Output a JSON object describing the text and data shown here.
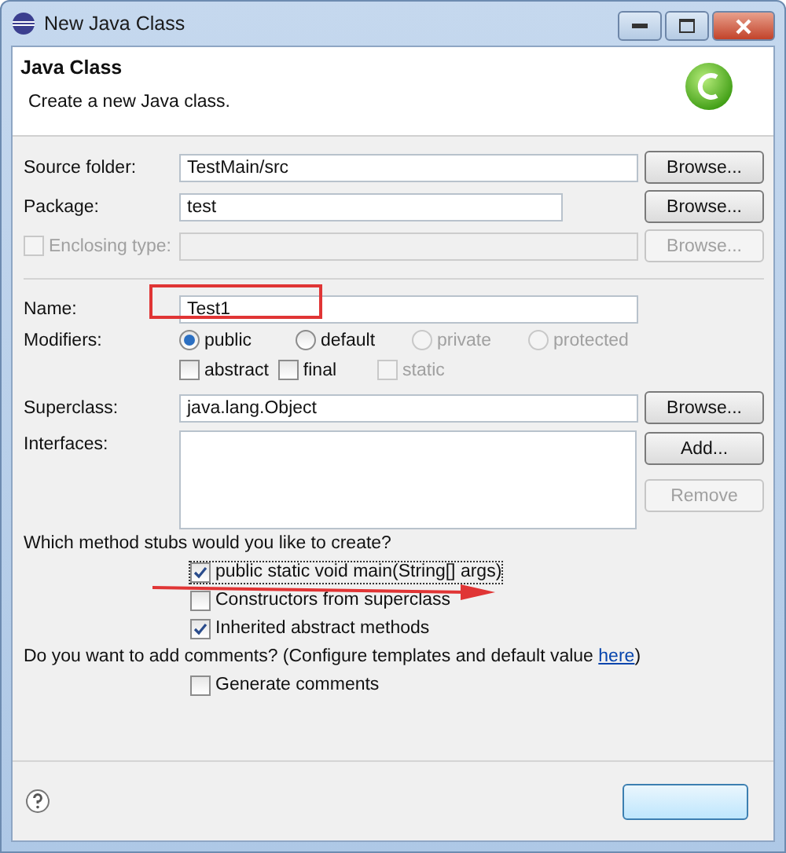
{
  "window": {
    "title": "New Java Class"
  },
  "header": {
    "title": "Java Class",
    "description": "Create a new Java class."
  },
  "source_folder": {
    "label": "Source folder:",
    "value": "TestMain/src",
    "button": {
      "label": "Browse...",
      "disabled": false
    }
  },
  "package": {
    "label": "Package:",
    "value": "test",
    "button": {
      "label": "Browse...",
      "disabled": false
    }
  },
  "enclosing_type": {
    "label": "Enclosing type:",
    "checked": false,
    "disabled": true,
    "button": {
      "label": "Browse...",
      "disabled": true
    }
  },
  "name": {
    "label": "Name:",
    "value": "Test1"
  },
  "modifiers": {
    "label": "Modifiers:",
    "access": [
      {
        "label": "public",
        "selected": true,
        "disabled": false
      },
      {
        "label": "default",
        "selected": false,
        "disabled": false
      },
      {
        "label": "private",
        "selected": false,
        "disabled": true
      },
      {
        "label": "protected",
        "selected": false,
        "disabled": true
      }
    ],
    "flags": [
      {
        "label": "abstract",
        "checked": false,
        "disabled": false
      },
      {
        "label": "final",
        "checked": false,
        "disabled": false
      },
      {
        "label": "static",
        "checked": false,
        "disabled": true
      }
    ]
  },
  "superclass": {
    "label": "Superclass:",
    "value": "java.lang.Object",
    "button": {
      "label": "Browse...",
      "disabled": false
    }
  },
  "interfaces": {
    "label": "Interfaces:",
    "buttons": [
      {
        "label": "Add...",
        "disabled": false
      },
      {
        "label": "Remove",
        "disabled": true
      }
    ]
  },
  "stubs": {
    "question": "Which method stubs would you like to create?",
    "options": [
      {
        "label": "public static void main(String[] args)",
        "checked": true
      },
      {
        "label": "Constructors from superclass",
        "checked": false
      },
      {
        "label": "Inherited abstract methods",
        "checked": true
      }
    ]
  },
  "comments": {
    "question": "Do you want to add comments? (Configure templates and default value ",
    "link": "here",
    "question_end": ")",
    "options": [
      {
        "label": "Generate comments",
        "checked": false
      }
    ]
  }
}
